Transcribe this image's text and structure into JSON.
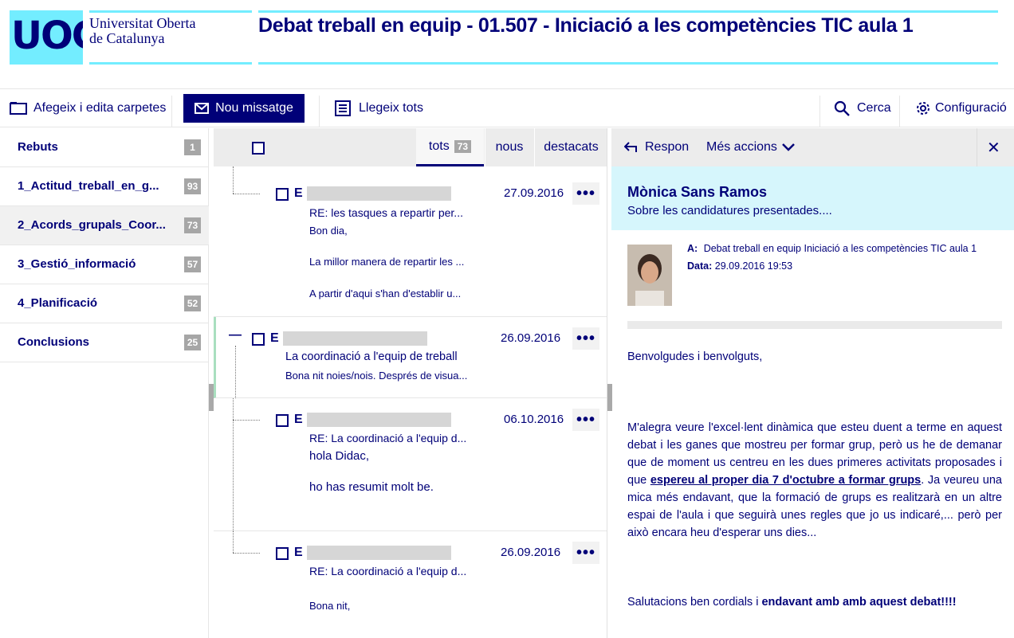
{
  "brand": {
    "logo_text": "UOC",
    "name_line1": "Universitat Oberta",
    "name_line2": "de Catalunya"
  },
  "page_title": "Debat treball en equip - 01.507 - Iniciació a les competències TIC aula 1",
  "toolbar": {
    "folders_label": "Afegeix i edita carpetes",
    "new_message_label": "Nou missatge",
    "read_all_label": "Llegeix tots",
    "search_label": "Cerca",
    "settings_label": "Configuració"
  },
  "folders": [
    {
      "name": "Rebuts",
      "count": "1"
    },
    {
      "name": "1_Actitud_treball_en_g...",
      "count": "93"
    },
    {
      "name": "2_Acords_grupals_Coor...",
      "count": "73"
    },
    {
      "name": "3_Gestió_informació",
      "count": "57"
    },
    {
      "name": "4_Planificació",
      "count": "52"
    },
    {
      "name": "Conclusions",
      "count": "25"
    }
  ],
  "list_tabs": {
    "all": "tots",
    "all_count": "73",
    "new": "nous",
    "starred": "destacats"
  },
  "messages": [
    {
      "sender_initial": "E",
      "date": "27.09.2016",
      "subject": "RE: les tasques a repartir per...",
      "lines": [
        "Bon dia,",
        "La millor manera de repartir les ...",
        "A partir d'aqui s'han d'establir u..."
      ]
    },
    {
      "sender_initial": "E",
      "date": "26.09.2016",
      "subject": "La coordinació a l'equip de treball",
      "lines": [
        "Bona nit noies/nois. Després de visua..."
      ]
    },
    {
      "sender_initial": "E",
      "date": "06.10.2016",
      "subject": "RE: La coordinació a l'equip d...",
      "lines": [
        "hola Didac,",
        "ho has resumit molt be."
      ]
    },
    {
      "sender_initial": "E",
      "date": "26.09.2016",
      "subject": "RE: La coordinació a l'equip d...",
      "lines": [
        "Bona nit,"
      ]
    }
  ],
  "more_label": "•••",
  "collapse_label": "—",
  "reader": {
    "reply_label": "Respon",
    "more_actions_label": "Més accions",
    "close_label": "✕",
    "author": "Mònica Sans Ramos",
    "subject": "Sobre les candidatures presentades....",
    "to_label": "A:",
    "to_value": "Debat treball en equip Iniciació a les competències TIC aula 1",
    "date_label": "Data:",
    "date_value": "29.09.2016 19:53",
    "greeting": "Benvolgudes i benvolguts,",
    "body_part1": "M'alegra veure l'excel·lent dinàmica que esteu duent a terme en aquest debat i les ganes que mostreu per formar grup, però us he de demanar que de moment us centreu en les dues primeres activitats proposades i que ",
    "body_link": "espereu al proper dia 7 d'octubre a formar grups",
    "body_part2": ". Ja veureu una mica més endavant, que la formació de grups es realitzarà en un altre espai de l'aula i que seguirà unes regles que jo us indicaré,... però per això encara heu d'esperar uns dies...",
    "closing_plain": "Salutacions ben cordials i ",
    "closing_bold": "endavant amb amb aquest debat!!!!"
  }
}
